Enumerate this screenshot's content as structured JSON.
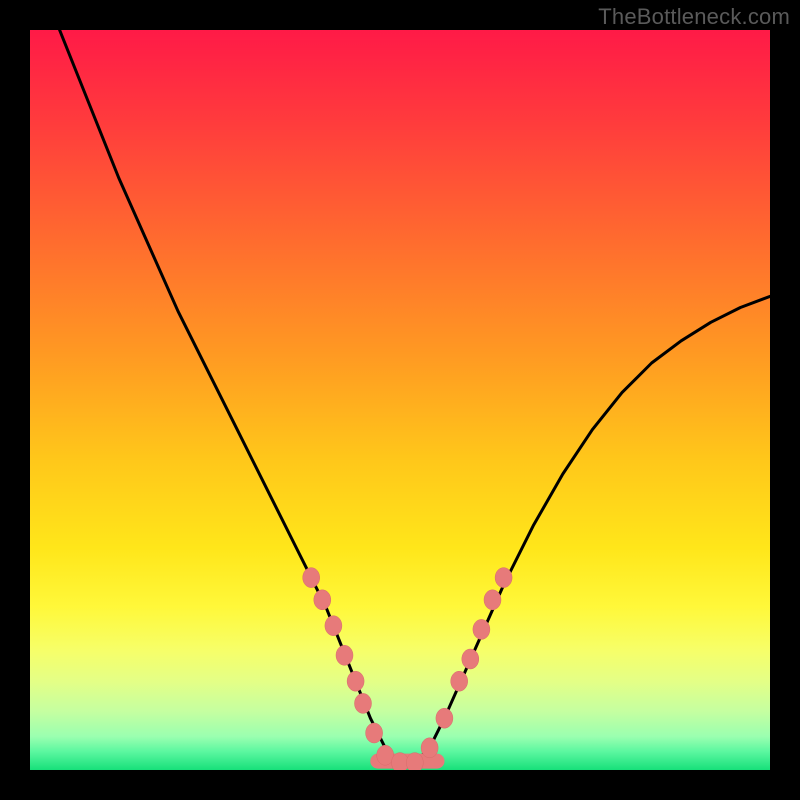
{
  "watermark": "TheBottleneck.com",
  "colors": {
    "frame": "#000000",
    "gradient_stops": [
      {
        "offset": 0.0,
        "color": "#ff1a47"
      },
      {
        "offset": 0.12,
        "color": "#ff3a3d"
      },
      {
        "offset": 0.28,
        "color": "#ff6a2f"
      },
      {
        "offset": 0.44,
        "color": "#ff9a22"
      },
      {
        "offset": 0.58,
        "color": "#ffc71a"
      },
      {
        "offset": 0.7,
        "color": "#ffe61a"
      },
      {
        "offset": 0.78,
        "color": "#fff83a"
      },
      {
        "offset": 0.84,
        "color": "#f6ff6a"
      },
      {
        "offset": 0.88,
        "color": "#e4ff86"
      },
      {
        "offset": 0.92,
        "color": "#c6ffa0"
      },
      {
        "offset": 0.955,
        "color": "#9affb0"
      },
      {
        "offset": 0.975,
        "color": "#5cf7a0"
      },
      {
        "offset": 1.0,
        "color": "#17e07a"
      }
    ],
    "curve_stroke": "#000000",
    "marker_fill": "#e77a7a",
    "marker_stroke": "#d86b6b"
  },
  "chart_data": {
    "type": "line",
    "title": "",
    "xlabel": "",
    "ylabel": "",
    "xlim": [
      0,
      100
    ],
    "ylim": [
      0,
      100
    ],
    "grid": false,
    "legend": false,
    "series": [
      {
        "name": "curve",
        "x": [
          4,
          8,
          12,
          16,
          20,
          24,
          28,
          32,
          36,
          38,
          40,
          42,
          44,
          46,
          48,
          50,
          52,
          54,
          56,
          60,
          64,
          68,
          72,
          76,
          80,
          84,
          88,
          92,
          96,
          100
        ],
        "y": [
          100,
          90,
          80,
          71,
          62,
          54,
          46,
          38,
          30,
          26,
          22,
          17,
          12,
          7,
          3,
          1,
          1,
          3,
          7,
          16,
          25,
          33,
          40,
          46,
          51,
          55,
          58,
          60.5,
          62.5,
          64
        ]
      }
    ],
    "markers": {
      "name": "highlight-dots",
      "points": [
        {
          "x": 38,
          "y": 26
        },
        {
          "x": 39.5,
          "y": 23
        },
        {
          "x": 41,
          "y": 19.5
        },
        {
          "x": 42.5,
          "y": 15.5
        },
        {
          "x": 44,
          "y": 12
        },
        {
          "x": 45,
          "y": 9
        },
        {
          "x": 46.5,
          "y": 5
        },
        {
          "x": 48,
          "y": 2
        },
        {
          "x": 50,
          "y": 1
        },
        {
          "x": 52,
          "y": 1
        },
        {
          "x": 54,
          "y": 3
        },
        {
          "x": 56,
          "y": 7
        },
        {
          "x": 58,
          "y": 12
        },
        {
          "x": 59.5,
          "y": 15
        },
        {
          "x": 61,
          "y": 19
        },
        {
          "x": 62.5,
          "y": 23
        },
        {
          "x": 64,
          "y": 26
        }
      ],
      "flat_segment": [
        {
          "x": 47,
          "y": 1.2
        },
        {
          "x": 55,
          "y": 1.2
        }
      ]
    }
  }
}
